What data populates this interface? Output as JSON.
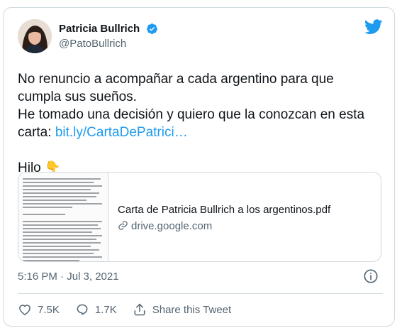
{
  "author": {
    "display_name": "Patricia Bullrich",
    "handle": "@PatoBullrich"
  },
  "tweet": {
    "text_1": "No renuncio a acompañar a cada argentino para que\ncumpla sus sueños.\nHe tomado una decisión y quiero que la conozcan en esta\ncarta: ",
    "link_text": "bit.ly/CartaDePatrici…",
    "text_2": "\n\nHilo ",
    "emoji": "👇"
  },
  "link_card": {
    "title": "Carta de Patricia Bullrich a los argentinos.pdf",
    "domain": "drive.google.com"
  },
  "meta": {
    "timestamp": "5:16 PM · Jul 3, 2021"
  },
  "actions": {
    "likes": "7.5K",
    "replies": "1.7K",
    "share_label": "Share this Tweet"
  },
  "colors": {
    "accent": "#1d9bf0",
    "text": "#0f1419",
    "secondary": "#536471",
    "border": "#cfd9de"
  },
  "icons": [
    "verified-badge-icon",
    "twitter-bird-icon",
    "link-icon",
    "info-icon",
    "heart-icon",
    "reply-icon",
    "share-icon"
  ]
}
